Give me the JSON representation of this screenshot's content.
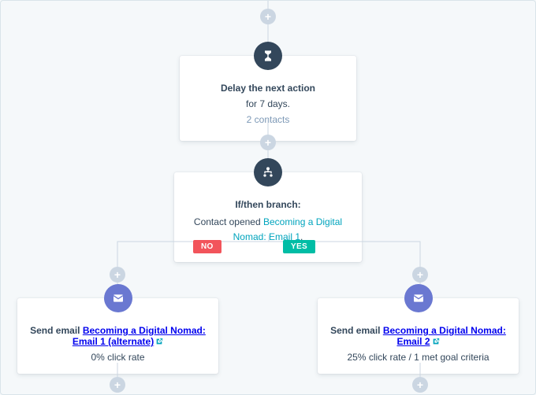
{
  "colors": {
    "bg": "#f5f8fa",
    "cardBg": "#ffffff",
    "text": "#33475b",
    "muted": "#7c98b6",
    "link": "#00a4bd",
    "connector": "#cbd6e2",
    "iconDelay": "#33475b",
    "iconBranch": "#33475b",
    "iconEmail": "#6a78d1",
    "tagNo": "#f2545b",
    "tagYes": "#00bda5"
  },
  "plusGlyph": "+",
  "delay": {
    "title": "Delay the next action",
    "duration": "for 7 days.",
    "contacts": "2 contacts"
  },
  "branch": {
    "title": "If/then branch:",
    "prefix": "Contact opened ",
    "linkText": "Becoming a Digital Nomad: Email 1",
    "suffix": ".",
    "noLabel": "NO",
    "yesLabel": "YES"
  },
  "emailLeft": {
    "titlePrefix": "Send email ",
    "linkText": "Becoming a Digital Nomad: Email 1 (alternate)",
    "rateValue": "0%",
    "rateSuffix": " click rate"
  },
  "emailRight": {
    "titlePrefix": "Send email ",
    "linkText": "Becoming a Digital Nomad: Email 2",
    "rateValue": "25%",
    "rateSuffix": " click rate / 1 met goal criteria"
  }
}
